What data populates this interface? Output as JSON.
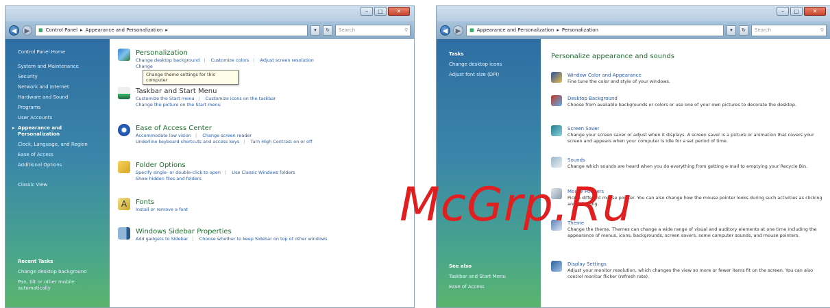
{
  "left_window": {
    "address": {
      "root": "Control Panel",
      "path": "Appearance and Personalization"
    },
    "search_placeholder": "Search",
    "side": {
      "items": [
        "Control Panel Home",
        "System and Maintenance",
        "Security",
        "Network and Internet",
        "Hardware and Sound",
        "Programs",
        "User Accounts",
        "Appearance and Personalization",
        "Clock, Language, and Region",
        "Ease of Access",
        "Additional Options",
        "Classic View"
      ],
      "recent_header": "Recent Tasks",
      "recent": [
        "Change desktop background",
        "Pan, tilt or other mobile automatically"
      ]
    },
    "categories": [
      {
        "title": "Personalization",
        "links": [
          "Change desktop background",
          "Customize colors",
          "Adjust screen resolution"
        ],
        "link2": [
          "Change"
        ]
      },
      {
        "title": "Taskbar and Start Menu",
        "links": [
          "Customize the Start menu",
          "Customize icons on the taskbar"
        ],
        "link2": [
          "Change the picture on the Start menu"
        ]
      },
      {
        "title": "Ease of Access Center",
        "links": [
          "Accommodate low vision",
          "Change screen reader"
        ],
        "link2": [
          "Underline keyboard shortcuts and access keys",
          "Turn High Contrast on or off"
        ]
      },
      {
        "title": "Folder Options",
        "links": [
          "Specify single- or double-click to open",
          "Use Classic Windows folders"
        ],
        "link2": [
          "Show hidden files and folders"
        ]
      },
      {
        "title": "Fonts",
        "links": [
          "Install or remove a font"
        ],
        "link2": []
      },
      {
        "title": "Windows Sidebar Properties",
        "links": [
          "Add gadgets to Sidebar",
          "Choose whether to keep Sidebar on top of other windows"
        ],
        "link2": []
      }
    ],
    "tooltip": "Change theme settings for this computer"
  },
  "right_window": {
    "address": {
      "root": "Appearance and Personalization",
      "path": "Personalization"
    },
    "search_placeholder": "Search",
    "side": {
      "header": "Tasks",
      "items": [
        "Change desktop icons",
        "Adjust font size (DPI)"
      ],
      "seealso_header": "See also",
      "seealso": [
        "Taskbar and Start Menu",
        "Ease of Access"
      ]
    },
    "heading": "Personalize appearance and sounds",
    "items": [
      {
        "title": "Window Color and Appearance",
        "desc": "Fine tune the color and style of your windows."
      },
      {
        "title": "Desktop Background",
        "desc": "Choose from available backgrounds or colors or use one of your own pictures to decorate the desktop."
      },
      {
        "title": "Screen Saver",
        "desc": "Change your screen saver or adjust when it displays. A screen saver is a picture or animation that covers your screen and appears when your computer is idle for a set period of time."
      },
      {
        "title": "Sounds",
        "desc": "Change which sounds are heard when you do everything from getting e-mail to emptying your Recycle Bin."
      },
      {
        "title": "Mouse Pointers",
        "desc": "Pick a different mouse pointer. You can also change how the mouse pointer looks during such activities as clicking and selecting."
      },
      {
        "title": "Theme",
        "desc": "Change the theme. Themes can change a wide range of visual and auditory elements at one time including the appearance of menus, icons, backgrounds, screen savers, some computer sounds, and mouse pointers."
      },
      {
        "title": "Display Settings",
        "desc": "Adjust your monitor resolution, which changes the view so more or fewer items fit on the screen. You can also control monitor flicker (refresh rate)."
      }
    ]
  },
  "watermark": "McGrp.Ru",
  "colors": {
    "accent_link": "#2a5aa8",
    "category_title": "#1e6e2e",
    "watermark": "#e02020"
  }
}
